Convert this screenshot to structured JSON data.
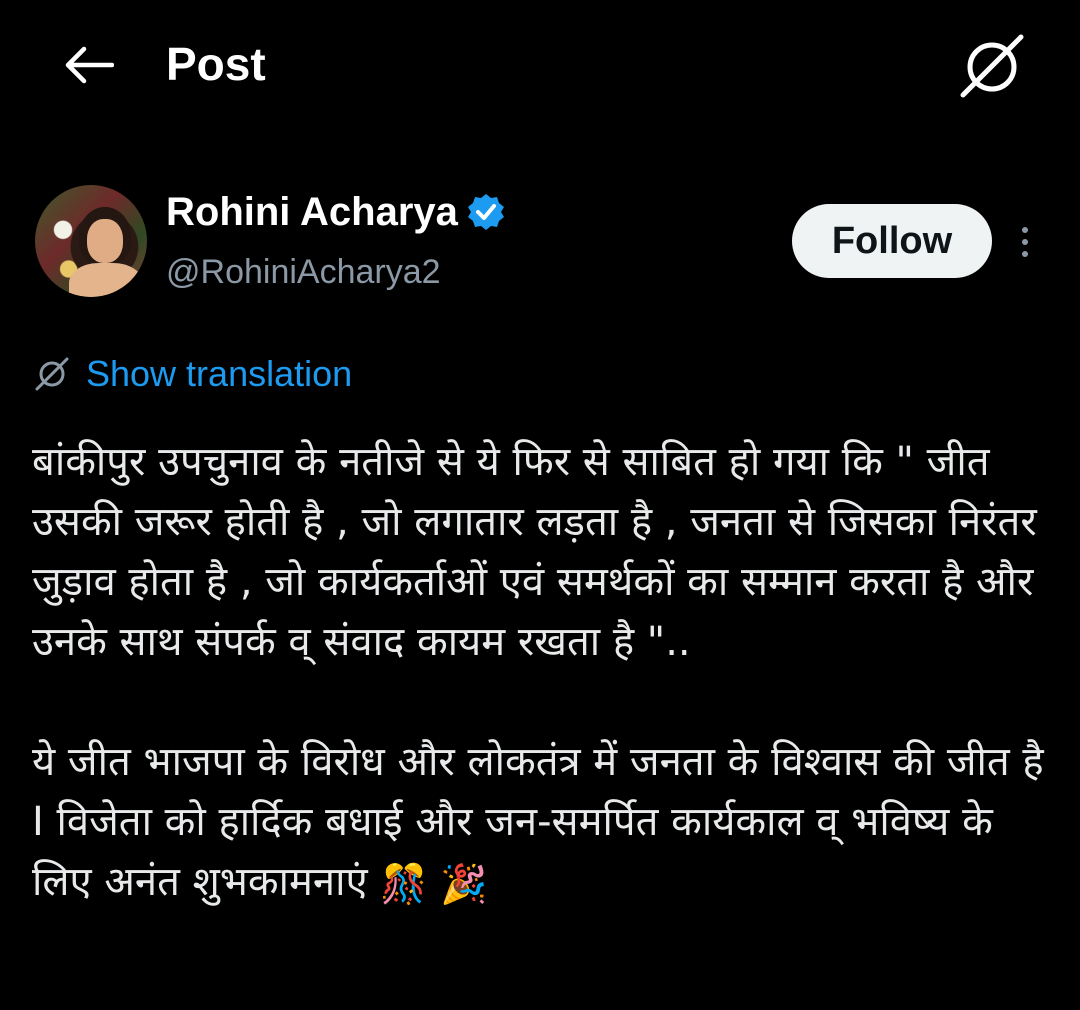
{
  "header": {
    "title": "Post",
    "back_icon": "arrow-left-icon",
    "translate_icon": "translate-icon"
  },
  "author": {
    "name": "Rohini Acharya",
    "handle": "@RohiniAcharya2",
    "verified": true,
    "verified_color": "#1d9bf0"
  },
  "actions": {
    "follow_label": "Follow",
    "more_icon": "more-vertical-icon"
  },
  "translation": {
    "label": "Show translation",
    "link_color": "#1d9bf0"
  },
  "post": {
    "paragraph_1": "बांकीपुर उपचुनाव के नतीजे से ये फिर से साबित हो गया कि \" जीत उसकी जरूर होती है , जो लगातार लड़ता है , जनता से जिसका निरंतर जुड़ाव होता है , जो कार्यकर्ताओं एवं समर्थकों का सम्मान करता है और उनके साथ संपर्क व् संवाद कायम रखता है \"..",
    "paragraph_2": "ये जीत भाजपा के विरोध और लोकतंत्र में जनता के विश्वास की जीत है I विजेता को हार्दिक बधाई  और जन-समर्पित कार्यकाल व् भविष्य के लिए अनंत शुभकामनाएं",
    "emoji_1": "🎊",
    "emoji_2": "🎉"
  }
}
